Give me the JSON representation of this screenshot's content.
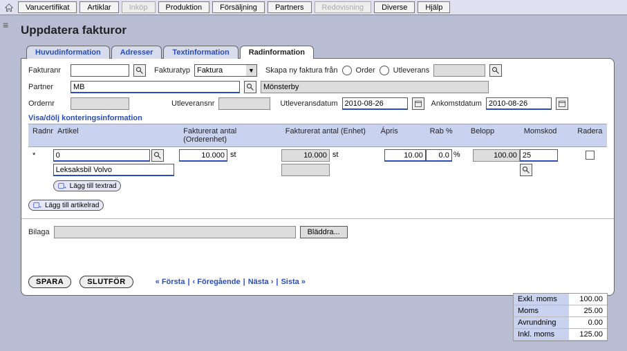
{
  "menu": {
    "items": [
      "Varucertifikat",
      "Artiklar",
      "Inköp",
      "Produktion",
      "Försäljning",
      "Partners",
      "Redovisning",
      "Diverse",
      "Hjälp"
    ],
    "disabled": [
      2,
      6
    ]
  },
  "page_title": "Uppdatera fakturor",
  "tabs": [
    "Huvudinformation",
    "Adresser",
    "Textinformation",
    "Radinformation"
  ],
  "active_tab": 3,
  "form": {
    "fakturanr_label": "Fakturanr",
    "fakturanr": "",
    "fakturatyp_label": "Fakturatyp",
    "fakturatyp": "Faktura",
    "skapa_label": "Skapa ny faktura från",
    "order_label": "Order",
    "utleverans_label": "Utleverans",
    "utlev_lookup": "",
    "partner_label": "Partner",
    "partner_code": "MB",
    "partner_name": "Mönsterby",
    "ordernr_label": "Ordernr",
    "ordernr": "",
    "utlevnr_label": "Utleveransnr",
    "utlevnr": "",
    "utlevdatum_label": "Utleveransdatum",
    "utlevdatum": "2010-08-26",
    "ankomstdatum_label": "Ankomstdatum",
    "ankomstdatum": "2010-08-26"
  },
  "grid": {
    "section_title": "Visa/dölj konteringsinformation",
    "headers": {
      "radnr": "Radnr",
      "artikel": "Artikel",
      "fakt_ord": "Fakturerat antal (Orderenhet)",
      "fakt_enh": "Fakturerat antal (Enhet)",
      "apris": "Ápris",
      "rab": "Rab %",
      "belopp": "Belopp",
      "momskod": "Momskod",
      "radera": "Radera"
    },
    "row": {
      "radnr": "*",
      "artikel_code": "0",
      "artikel_name": "Leksaksbil Volvo",
      "fakt_ord": "10.000",
      "ord_unit": "st",
      "fakt_enh": "10.000",
      "enh_unit": "st",
      "apris": "10.00",
      "rab": "0.0",
      "rab_unit": "%",
      "belopp": "100.00",
      "momskod": "25"
    },
    "add_textrow": "Lägg till textrad",
    "add_artrow": "Lägg till artikelrad"
  },
  "attach": {
    "label": "Bilaga",
    "value": "",
    "browse": "Bläddra..."
  },
  "totals": {
    "exkl_label": "Exkl. moms",
    "exkl": "100.00",
    "moms_label": "Moms",
    "moms": "25.00",
    "avr_label": "Avrundning",
    "avr": "0.00",
    "inkl_label": "Inkl. moms",
    "inkl": "125.00"
  },
  "actions": {
    "save": "SPARA",
    "finish": "SLUTFÖR",
    "first": "« Första",
    "prev": "‹ Föregående",
    "next": "Nästa ›",
    "last": "Sista »",
    "sep": "|"
  }
}
